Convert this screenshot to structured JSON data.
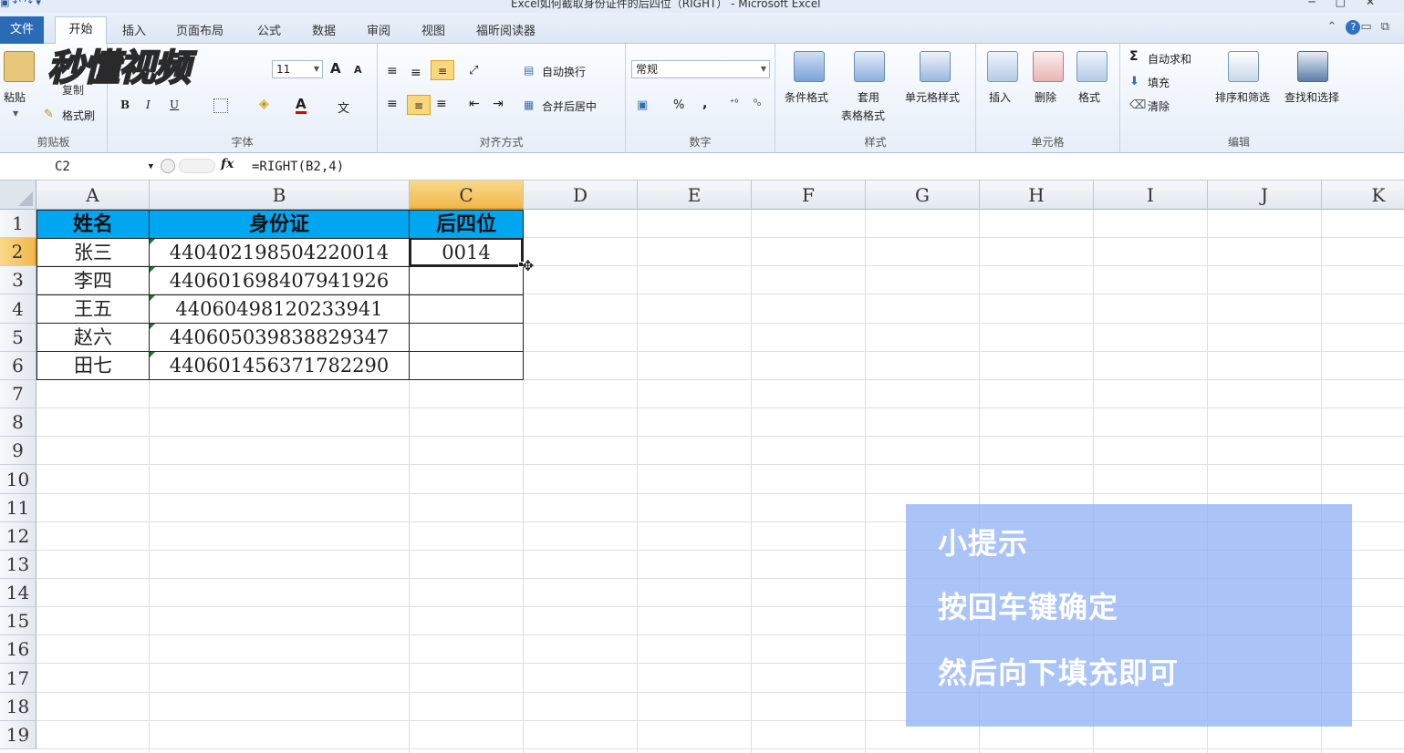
{
  "window": {
    "title": "Excel如何截取身份证件的后四位（RIGHT） - Microsoft Excel",
    "controls": [
      "─",
      "□",
      "✕"
    ]
  },
  "tabs": {
    "file": "文件",
    "home": "开始",
    "insert": "插入",
    "page_layout": "页面布局",
    "formulas": "公式",
    "data": "数据",
    "review": "审阅",
    "view": "视图",
    "foxit": "福昕阅读器"
  },
  "ribbon": {
    "clipboard": {
      "paste": "粘贴",
      "copy": "复制",
      "format_painter": "格式刷",
      "label": "剪贴板"
    },
    "font": {
      "size": "11",
      "bold": "B",
      "italic": "I",
      "underline": "U",
      "grow": "A",
      "shrink": "A",
      "font_color": "A",
      "wen": "文",
      "label": "字体"
    },
    "alignment": {
      "wrap": "自动换行",
      "merge": "合并后居中",
      "label": "对齐方式"
    },
    "number": {
      "format": "常规",
      "percent": "%",
      "comma": ",",
      "label": "数字"
    },
    "styles": {
      "conditional": "条件格式",
      "table_1": "套用",
      "table_2": "表格格式",
      "cell_styles": "单元格样式",
      "label": "样式"
    },
    "cells": {
      "insert": "插入",
      "delete": "删除",
      "format": "格式",
      "label": "单元格"
    },
    "editing": {
      "autosum": "自动求和",
      "fill": "填充",
      "clear": "清除",
      "sort": "排序和筛选",
      "find": "查找和选择",
      "label": "编辑"
    }
  },
  "watermark": "秒懂视频",
  "formula_bar": {
    "name_box": "C2",
    "fx": "fx",
    "formula": "=RIGHT(B2,4)"
  },
  "sheet": {
    "columns": [
      "A",
      "B",
      "C",
      "D",
      "E",
      "F",
      "G",
      "H",
      "I",
      "J",
      "K"
    ],
    "rows": [
      "1",
      "2",
      "3",
      "4",
      "5",
      "6",
      "7",
      "8",
      "9",
      "10",
      "11",
      "12",
      "13",
      "14",
      "15",
      "16",
      "17",
      "18",
      "19"
    ],
    "header": {
      "name": "姓名",
      "id": "身份证",
      "last4": "后四位"
    },
    "records": [
      {
        "name": "张三",
        "id": "440402198504220014",
        "last4": "0014"
      },
      {
        "name": "李四",
        "id": "440601698407941926",
        "last4": ""
      },
      {
        "name": "王五",
        "id": "44060498120233941",
        "last4": ""
      },
      {
        "name": "赵六",
        "id": "440605039838829347",
        "last4": ""
      },
      {
        "name": "田七",
        "id": "440601456371782290",
        "last4": ""
      }
    ],
    "header_color": "#00A6EF",
    "selection_color": "#F1B94A"
  },
  "tip": {
    "title": "小提示",
    "line1": "按回车键确定",
    "line2": "然后向下填充即可"
  }
}
